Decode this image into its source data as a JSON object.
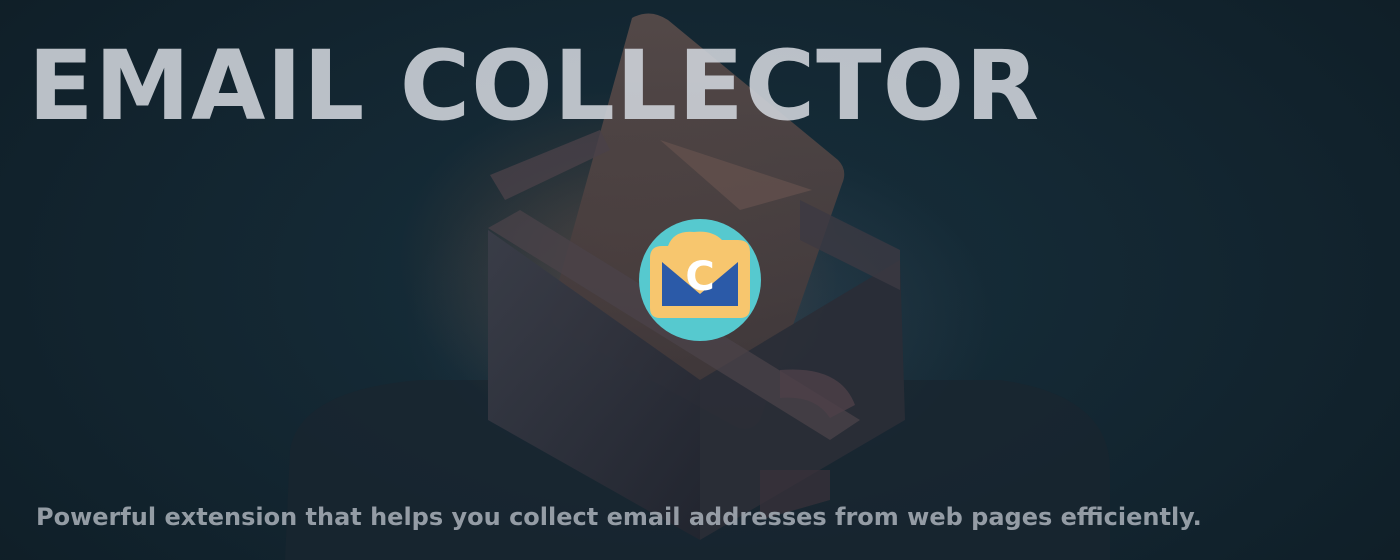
{
  "banner": {
    "title": "EMAIL COLLECTOR",
    "tagline": "Powerful extension that helps you collect email addresses from web pages efficiently.",
    "background_illustration": "mailbox-with-envelope",
    "logo": {
      "icon": "envelope-c-logo-icon",
      "letter": "C",
      "colors": {
        "circle": "#56c9cf",
        "envelope": "#f7c66e",
        "envelope_inner": "#2b5aa8",
        "letter": "#ffffff"
      }
    },
    "colors": {
      "background": "#13232d",
      "title": "#cdd2d8",
      "tagline": "#aab2ba"
    }
  }
}
